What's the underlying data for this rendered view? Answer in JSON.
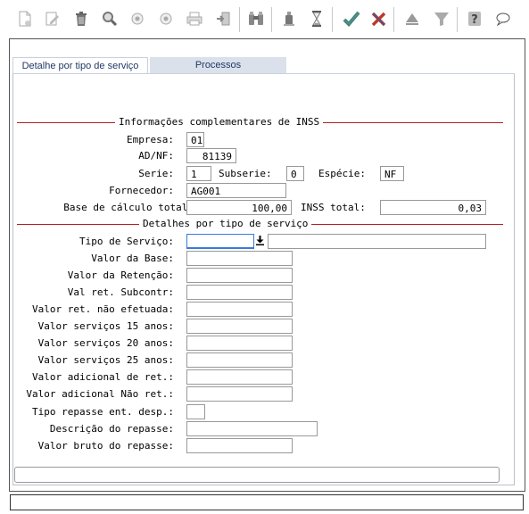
{
  "toolbar": {
    "icons": [
      "new-document",
      "edit-pencil",
      "trash",
      "magnifier",
      "circle-prev",
      "circle-next",
      "print",
      "export",
      "binoculars",
      "bottle",
      "hourglass",
      "confirm-check",
      "cancel-x",
      "move-up",
      "filter-down",
      "help",
      "chat"
    ]
  },
  "tabs": [
    {
      "label": "Detalhe por tipo de serviço"
    },
    {
      "label": "Processos"
    }
  ],
  "section_inss": {
    "title": "Informações complementares de INSS",
    "empresa_label": "Empresa:",
    "empresa_value": "01",
    "adnf_label": "AD/NF:",
    "adnf_value": "81139",
    "serie_label": "Serie:",
    "serie_value": "1",
    "subserie_label": "Subserie:",
    "subserie_value": "0",
    "especie_label": "Espécie:",
    "especie_value": "NF",
    "fornecedor_label": "Fornecedor:",
    "fornecedor_value": "AG001",
    "base_label": "Base de cálculo total:",
    "base_value": "100,00",
    "inss_label": "INSS total:",
    "inss_value": "0,03"
  },
  "section_detalhes": {
    "title": "Detalhes por tipo de serviço",
    "tipo_servico_label": "Tipo de Serviço:",
    "valor_base_label": "Valor da Base:",
    "valor_retencao_label": "Valor da Retenção:",
    "val_ret_subcontr_label": "Val ret. Subcontr:",
    "valor_ret_nao_efetuada_label": "Valor ret. não efetuada:",
    "valor_servicos_15_label": "Valor serviços 15 anos:",
    "valor_servicos_20_label": "Valor serviços 20 anos:",
    "valor_servicos_25_label": "Valor serviços 25 anos:",
    "valor_adicional_ret_label": "Valor adicional de ret.:",
    "valor_adicional_nao_ret_label": "Valor adicional Não ret.:",
    "tipo_repasse_label": "Tipo repasse ent. desp.:",
    "descricao_repasse_label": "Descrição do repasse:",
    "valor_bruto_repasse_label": "Valor bruto do repasse:"
  },
  "colors": {
    "legend_line": "#b22222",
    "tab_text": "#1f3a66",
    "tab_inactive_bg": "#dbe1eb",
    "focus": "#3a7bd5"
  }
}
